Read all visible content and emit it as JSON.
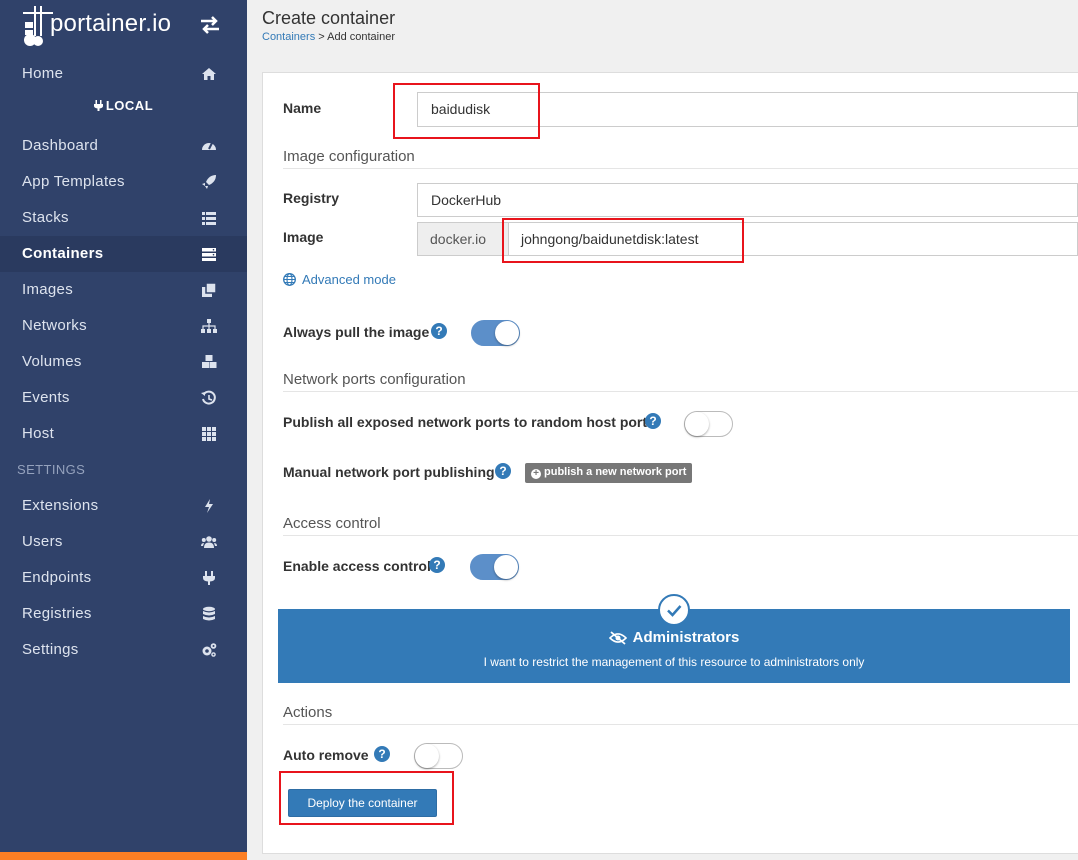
{
  "brand": {
    "name": "portainer.io"
  },
  "sidebar": {
    "home": "Home",
    "endpoint": "LOCAL",
    "items": [
      {
        "label": "Dashboard",
        "icon": "tachometer-icon"
      },
      {
        "label": "App Templates",
        "icon": "rocket-icon"
      },
      {
        "label": "Stacks",
        "icon": "th-list-icon"
      },
      {
        "label": "Containers",
        "icon": "server-icon"
      },
      {
        "label": "Images",
        "icon": "clone-icon"
      },
      {
        "label": "Networks",
        "icon": "sitemap-icon"
      },
      {
        "label": "Volumes",
        "icon": "cubes-icon"
      },
      {
        "label": "Events",
        "icon": "history-icon"
      },
      {
        "label": "Host",
        "icon": "th-icon"
      }
    ],
    "settings_title": "SETTINGS",
    "settings_items": [
      {
        "label": "Extensions",
        "icon": "bolt-icon"
      },
      {
        "label": "Users",
        "icon": "users-icon"
      },
      {
        "label": "Endpoints",
        "icon": "plug-icon"
      },
      {
        "label": "Registries",
        "icon": "database-icon"
      },
      {
        "label": "Settings",
        "icon": "cogs-icon"
      }
    ],
    "active": "Containers"
  },
  "header": {
    "title": "Create container",
    "breadcrumb_link": "Containers",
    "breadcrumb_sep": " > ",
    "breadcrumb_current": "Add container"
  },
  "form": {
    "name_label": "Name",
    "name_value": "baidudisk",
    "image_config_title": "Image configuration",
    "registry_label": "Registry",
    "registry_value": "DockerHub",
    "image_label": "Image",
    "image_prefix": "docker.io",
    "image_value": "johngong/baidunetdisk:latest",
    "advanced_mode": "Advanced mode",
    "always_pull_label": "Always pull the image",
    "always_pull": true,
    "network_title": "Network ports configuration",
    "publish_all_label": "Publish all exposed network ports to random host ports",
    "publish_all": false,
    "manual_publish_label": "Manual network port publishing",
    "publish_new_button": "publish a new network port",
    "access_title": "Access control",
    "enable_access_label": "Enable access control",
    "enable_access": true,
    "admin_title": "Administrators",
    "admin_desc": "I want to restrict the management of this resource to administrators only",
    "actions_title": "Actions",
    "auto_remove_label": "Auto remove",
    "auto_remove": false,
    "deploy_button": "Deploy the container",
    "help_glyph": "?"
  },
  "colors": {
    "sidebar_bg": "#30426a",
    "accent": "#337ab7",
    "toggle_on": "#5c8fc9",
    "highlight": "#e8141c",
    "bottom_bar": "#fc7f24"
  }
}
